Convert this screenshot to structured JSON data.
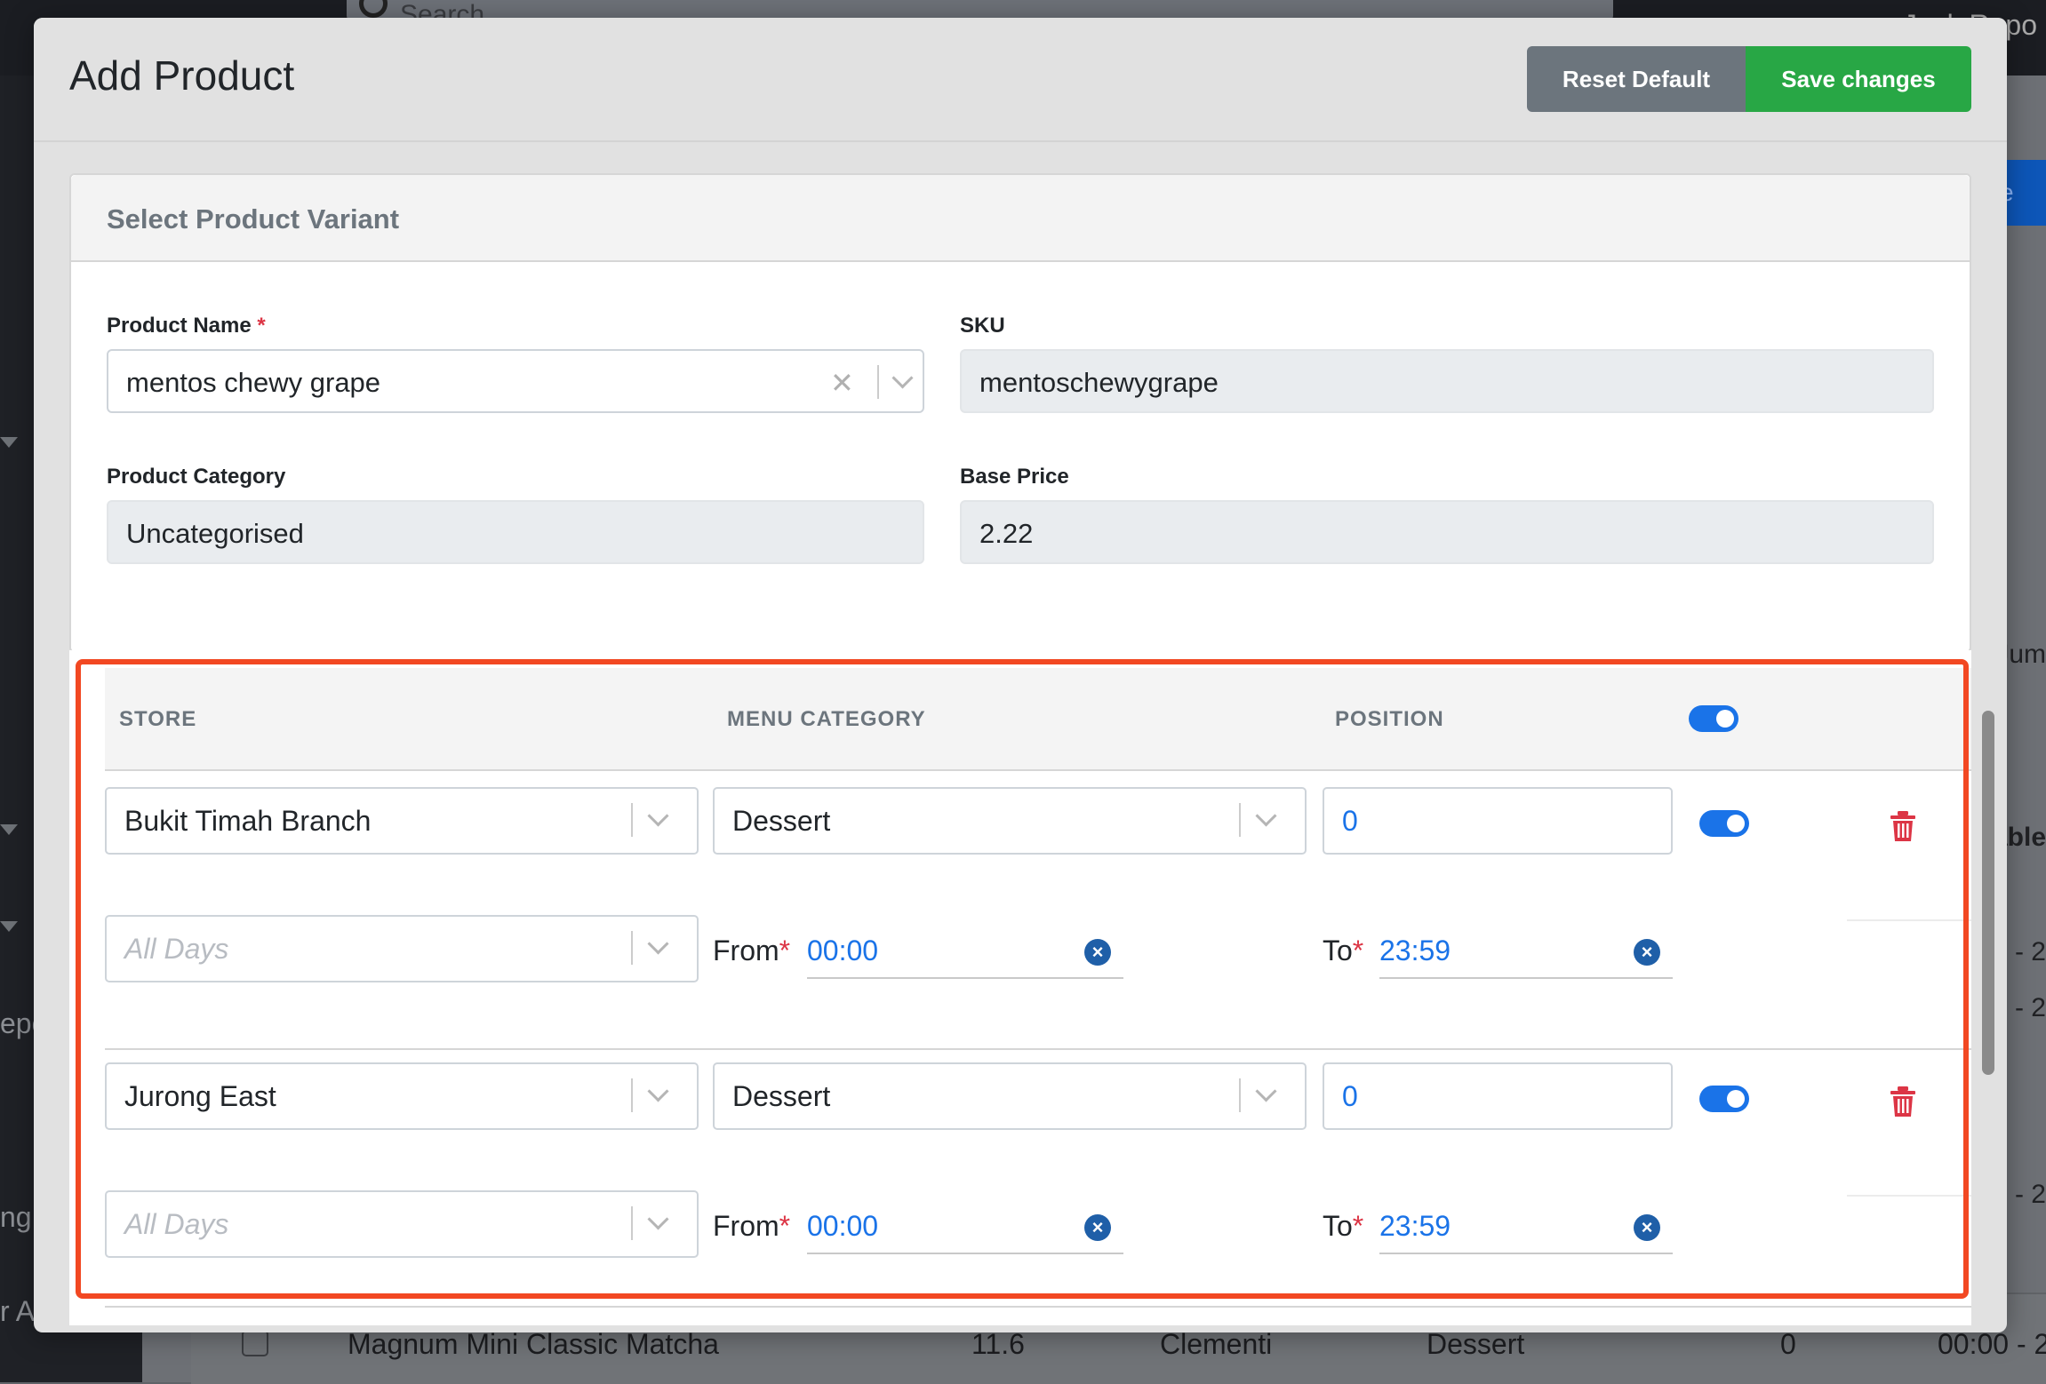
{
  "background": {
    "search_placeholder": "Search",
    "user_text": "Jack Repo",
    "blue_button_text": "e",
    "sidebar_fragments": [
      "epo",
      "ng",
      "r A"
    ],
    "right_fragments": [
      "Jum",
      "able",
      ") - 2",
      ") - 2",
      ") - 2"
    ],
    "table_row": {
      "product": "Magnum Mini Classic Matcha",
      "price": "11.6",
      "store": "Clementi",
      "category": "Dessert",
      "position": "0",
      "time": "00:00 - 2"
    }
  },
  "modal": {
    "title": "Add Product",
    "reset_label": "Reset Default",
    "save_label": "Save changes",
    "variant_card": {
      "title": "Select Product Variant",
      "product_name_label": "Product Name",
      "product_name_value": "mentos chewy grape",
      "sku_label": "SKU",
      "sku_value": "mentoschewygrape",
      "category_label": "Product Category",
      "category_value": "Uncategorised",
      "base_price_label": "Base Price",
      "base_price_value": "2.22",
      "required_mark": "*"
    },
    "store_table": {
      "headers": {
        "store": "STORE",
        "menu_category": "MENU CATEGORY",
        "position": "POSITION"
      },
      "from_label": "From",
      "to_label": "To",
      "required_mark": "*",
      "rows": [
        {
          "store": "Bukit Timah Branch",
          "menu_category": "Dessert",
          "position": "0",
          "days_placeholder": "All Days",
          "from": "00:00",
          "to": "23:59",
          "enabled": true
        },
        {
          "store": "Jurong East",
          "menu_category": "Dessert",
          "position": "0",
          "days_placeholder": "All Days",
          "from": "00:00",
          "to": "23:59",
          "enabled": true
        }
      ]
    }
  },
  "colors": {
    "save": "#28a745",
    "reset": "#6c757d",
    "toggle": "#1a73e8",
    "trash": "#dc3545",
    "highlight": "#f24822"
  }
}
